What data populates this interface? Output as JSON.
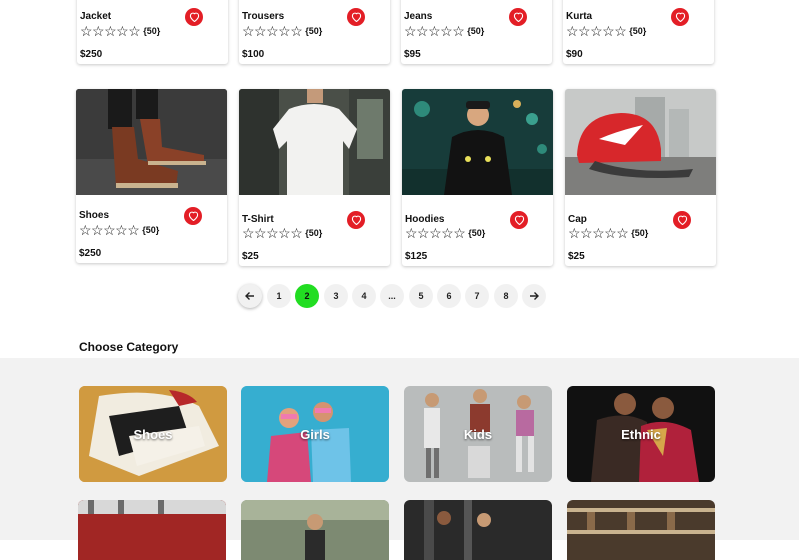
{
  "top_products": [
    {
      "name": "Jacket",
      "rating_count": "{50}",
      "price": "$250",
      "stars": 0
    },
    {
      "name": "Trousers",
      "rating_count": "{50}",
      "price": "$100",
      "stars": 0
    },
    {
      "name": "Jeans",
      "rating_count": "{50}",
      "price": "$95",
      "stars": 0
    },
    {
      "name": "Kurta",
      "rating_count": "{50}",
      "price": "$90",
      "stars": 0
    }
  ],
  "products": [
    {
      "name": "Shoes",
      "rating_count": "{50}",
      "price": "$250",
      "stars": 0,
      "image": "boots-photo"
    },
    {
      "name": "T-Shirt",
      "rating_count": "{50}",
      "price": "$25",
      "stars": 0,
      "image": "tshirt-photo"
    },
    {
      "name": "Hoodies",
      "rating_count": "{50}",
      "price": "$125",
      "stars": 0,
      "image": "hoodie-photo"
    },
    {
      "name": "Cap",
      "rating_count": "{50}",
      "price": "$25",
      "stars": 0,
      "image": "cap-photo"
    }
  ],
  "pagination": {
    "prev_icon": "arrow-left-icon",
    "next_icon": "arrow-right-icon",
    "pages": [
      "1",
      "2",
      "3",
      "4",
      "...",
      "5",
      "6",
      "7",
      "8"
    ],
    "active_page": "2",
    "active_color": "#22dd22"
  },
  "categories_section": {
    "title": "Choose Category",
    "categories": [
      {
        "label": "Shoes"
      },
      {
        "label": "Girls"
      },
      {
        "label": "Kids"
      },
      {
        "label": "Ethnic"
      }
    ]
  },
  "colors": {
    "heart": "#e31e26",
    "band": "#f2f2f2"
  }
}
